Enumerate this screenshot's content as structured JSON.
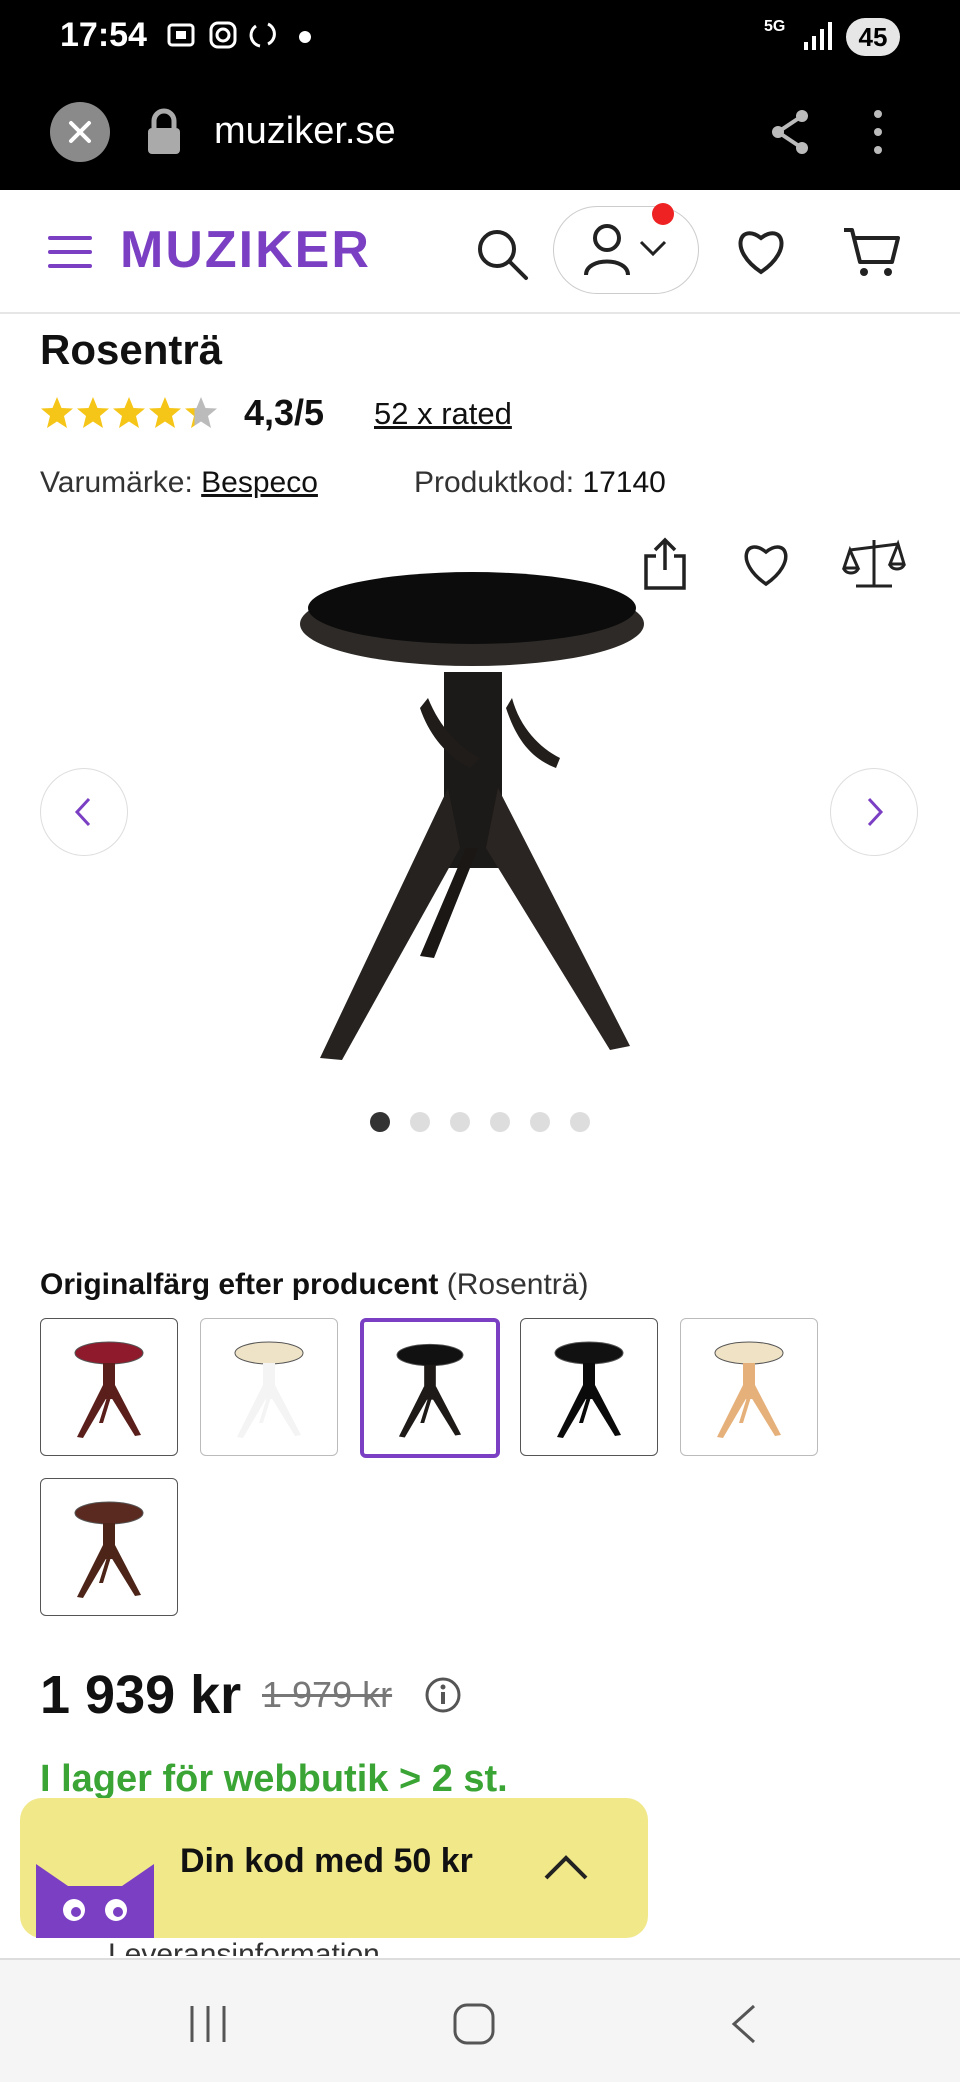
{
  "status_bar": {
    "time": "17:54",
    "network": "5G",
    "battery": "45"
  },
  "browser": {
    "url": "muziker.se"
  },
  "site_header": {
    "logo": "MUZIKER"
  },
  "product": {
    "title": "Rosenträ",
    "rating": {
      "stars": 4.3,
      "score": "4,3/5",
      "count_text": "52 x rated"
    },
    "brand_label": "Varumärke:",
    "brand": "Bespeco",
    "code_label": "Produktkod:",
    "code": "17140",
    "gallery": {
      "dot_count": 6,
      "active_dot": 1
    },
    "color_label": "Originalfärg efter producent",
    "color_selected": "(Rosenträ)",
    "swatches": [
      {
        "name": "mahogany-red",
        "seat": "#8e1a2b",
        "legs": "#5a1f1a"
      },
      {
        "name": "white",
        "seat": "#efe3c7",
        "legs": "#f4f4f4"
      },
      {
        "name": "rosewood-black",
        "seat": "#111111",
        "legs": "#1e1a18",
        "selected": true
      },
      {
        "name": "black-gloss",
        "seat": "#111111",
        "legs": "#0a0a0a"
      },
      {
        "name": "natural",
        "seat": "#f0e2c4",
        "legs": "#e5b07a"
      },
      {
        "name": "walnut",
        "seat": "#5a2a20",
        "legs": "#4c2418"
      }
    ],
    "price": "1 939 kr",
    "old_price": "1 979 kr",
    "stock": "I lager för webbutik > 2 st.",
    "delivery": "Leveransinformation"
  },
  "promo": {
    "text": "Din kod med 50 kr"
  },
  "colors": {
    "accent": "#7b3fc4",
    "stock": "#3aa535",
    "promo_bg": "#f1e88a",
    "star": "#f5c518"
  }
}
